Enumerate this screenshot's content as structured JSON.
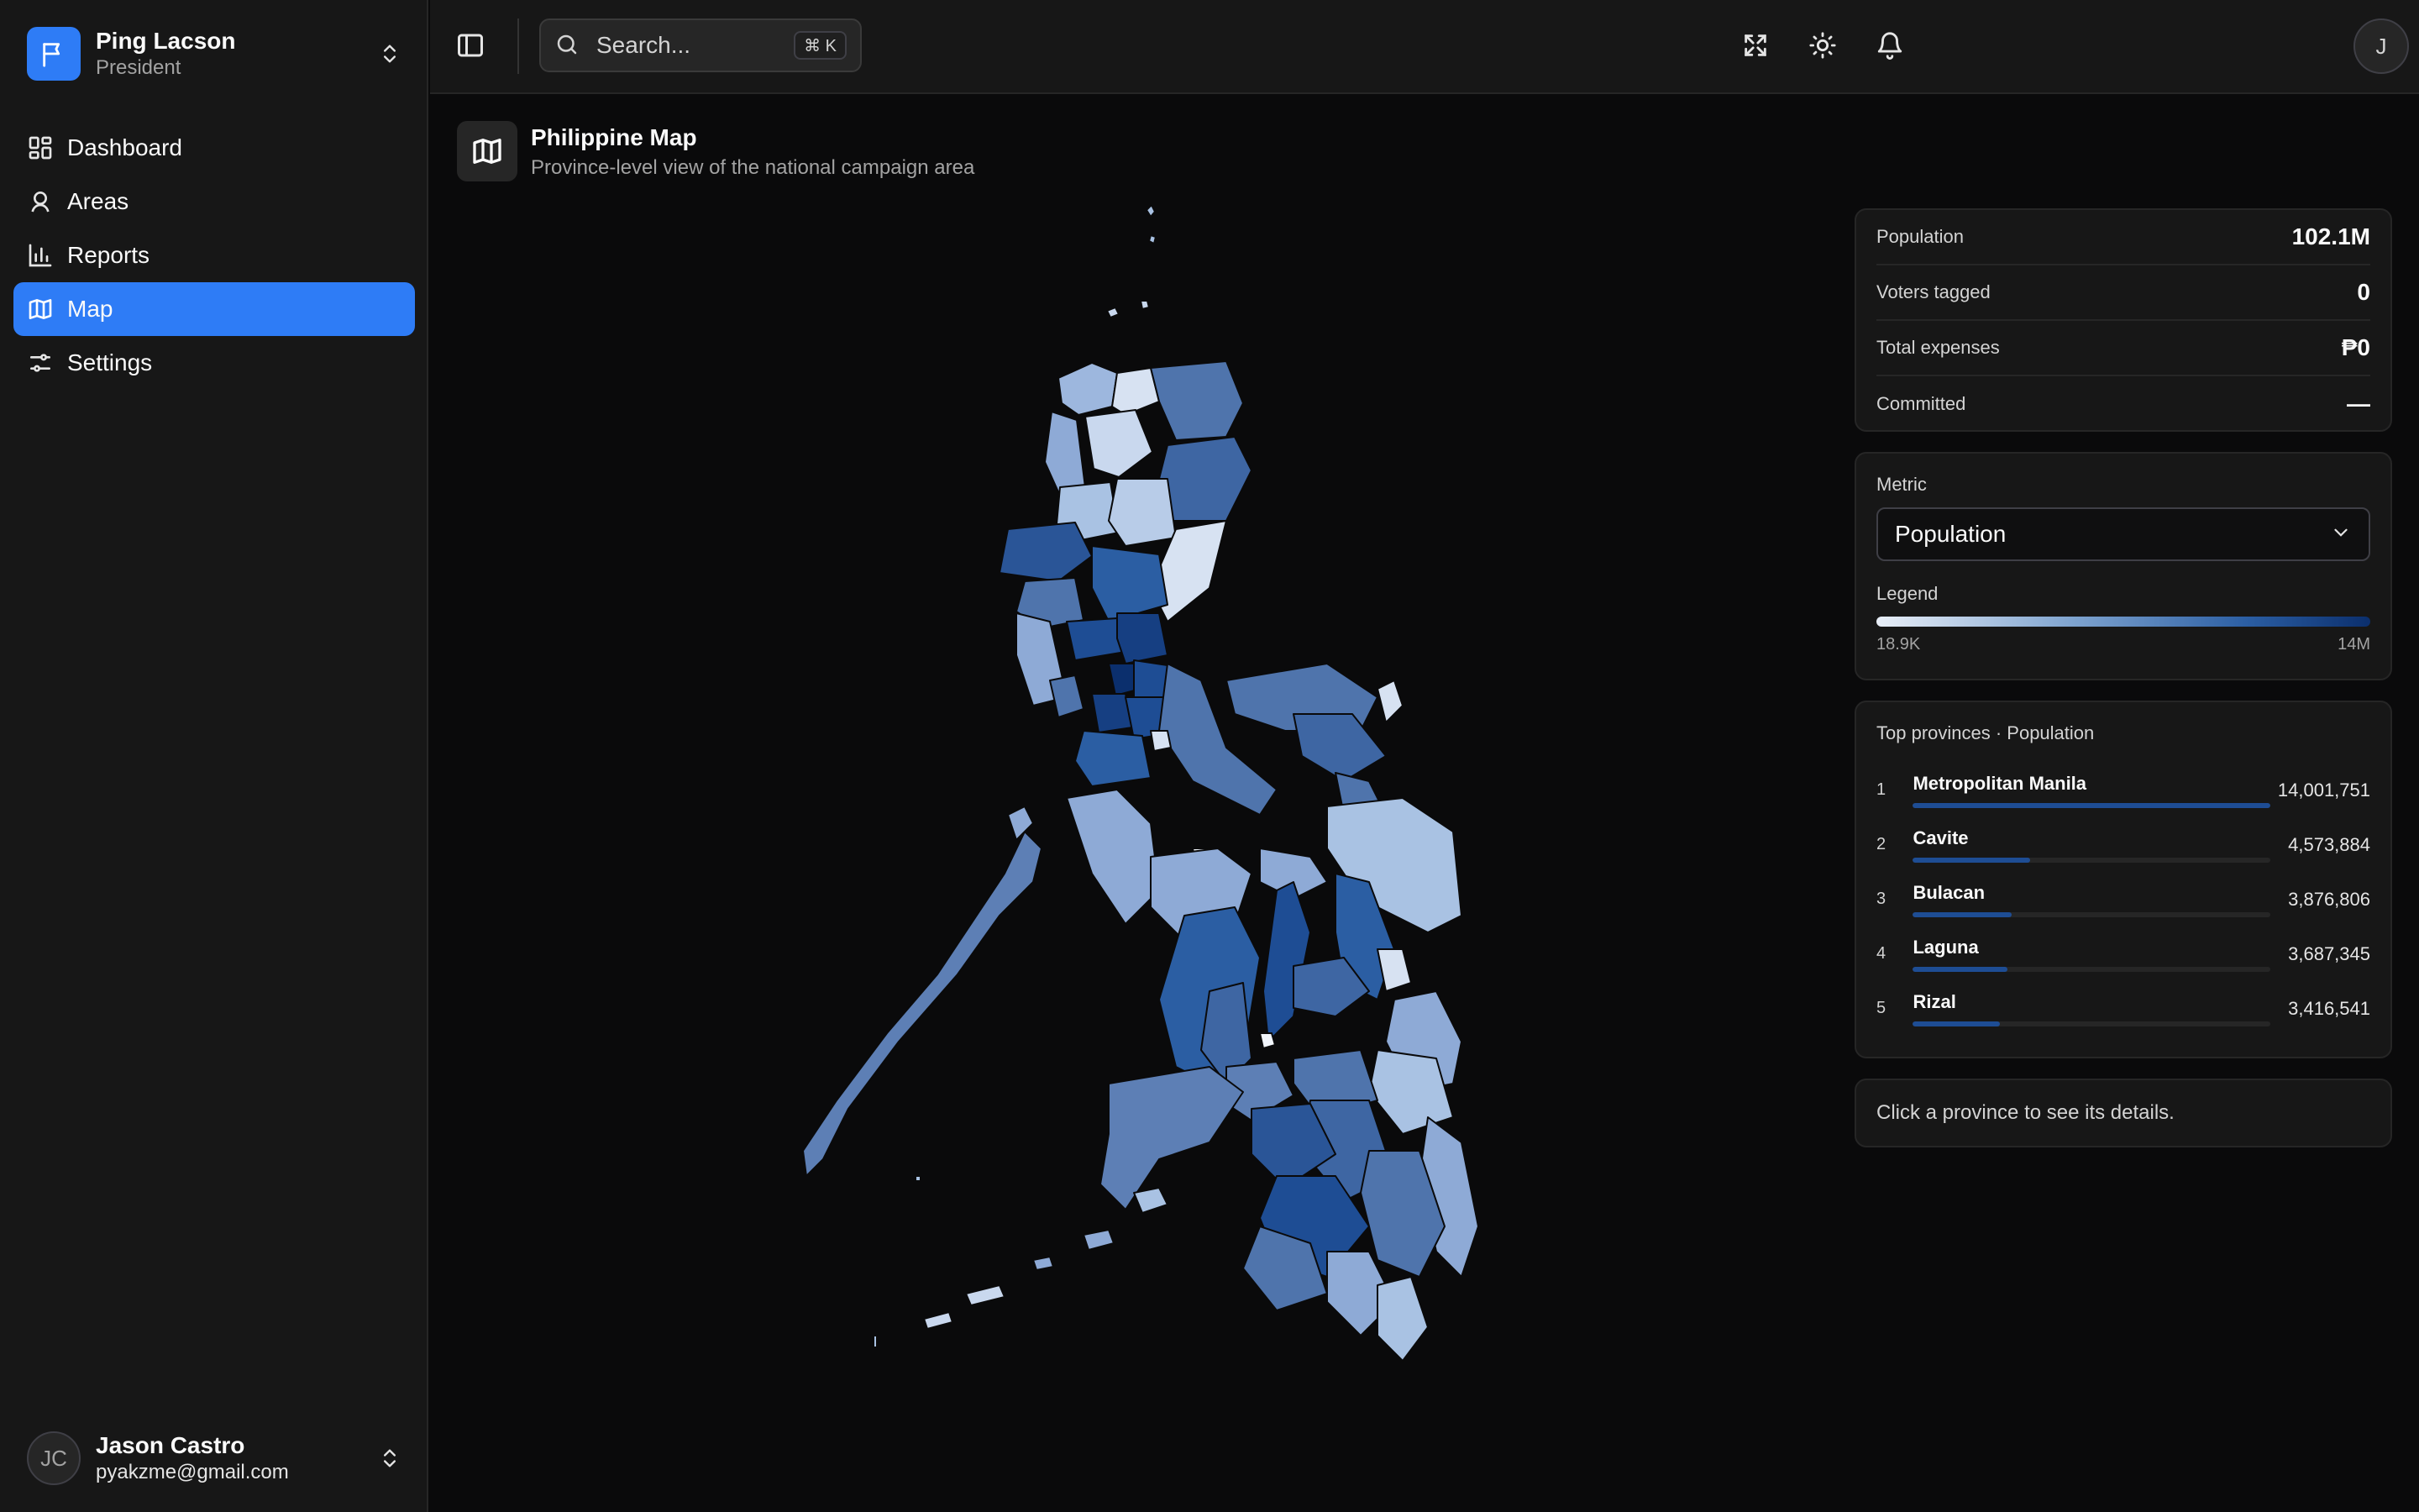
{
  "team": {
    "name": "Ping Lacson",
    "role": "President"
  },
  "nav": {
    "items": [
      {
        "label": "Dashboard",
        "icon": "dashboard-icon",
        "active": false
      },
      {
        "label": "Areas",
        "icon": "map-pin-icon",
        "active": false
      },
      {
        "label": "Reports",
        "icon": "bar-chart-icon",
        "active": false
      },
      {
        "label": "Map",
        "icon": "map-icon",
        "active": true
      },
      {
        "label": "Settings",
        "icon": "sliders-icon",
        "active": false
      }
    ]
  },
  "user": {
    "initials": "JC",
    "name": "Jason Castro",
    "email": "pyakzme@gmail.com"
  },
  "header": {
    "search_placeholder": "Search...",
    "shortcut": "⌘ K",
    "avatar_initial": "J"
  },
  "page": {
    "title": "Philippine Map",
    "subtitle": "Province-level view of the national campaign area"
  },
  "stats": [
    {
      "label": "Population",
      "value": "102.1M"
    },
    {
      "label": "Voters tagged",
      "value": "0"
    },
    {
      "label": "Total expenses",
      "value": "₱0"
    },
    {
      "label": "Committed",
      "value": "—"
    }
  ],
  "metric": {
    "label": "Metric",
    "selected": "Population",
    "legend_label": "Legend",
    "legend_min": "18.9K",
    "legend_max": "14M"
  },
  "top_provinces": {
    "title": "Top provinces · Population",
    "items": [
      {
        "rank": "1",
        "name": "Metropolitan Manila",
        "value": "14,001,751",
        "share": 1.0
      },
      {
        "rank": "2",
        "name": "Cavite",
        "value": "4,573,884",
        "share": 0.327
      },
      {
        "rank": "3",
        "name": "Bulacan",
        "value": "3,876,806",
        "share": 0.277
      },
      {
        "rank": "4",
        "name": "Laguna",
        "value": "3,687,345",
        "share": 0.263
      },
      {
        "rank": "5",
        "name": "Rizal",
        "value": "3,416,541",
        "share": 0.244
      }
    ]
  },
  "hint": "Click a province to see its details.",
  "colors": {
    "accent": "#2e7cf6",
    "map_dark": "#0b2f6d",
    "map_light": "#e8eef7"
  }
}
